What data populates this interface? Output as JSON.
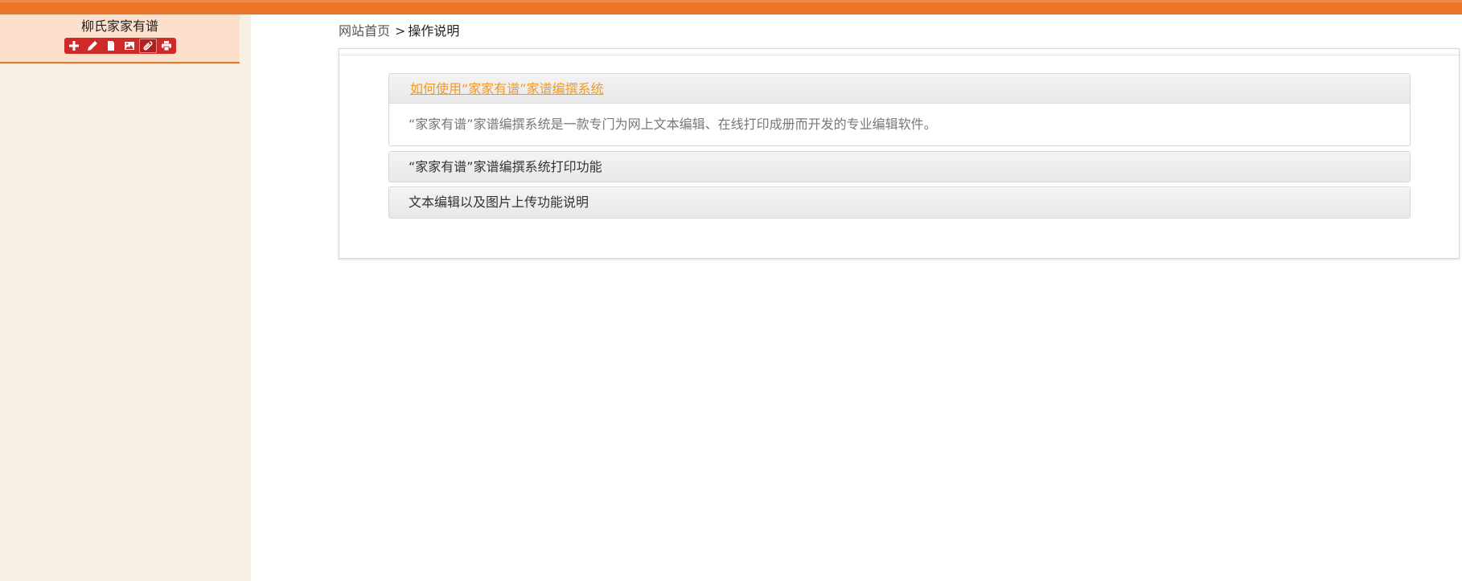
{
  "sidebar": {
    "site_name": "柳氏家家有谱",
    "tools": [
      {
        "icon": "plus-icon"
      },
      {
        "icon": "pencil-icon"
      },
      {
        "icon": "document-icon"
      },
      {
        "icon": "image-icon"
      },
      {
        "icon": "paperclip-icon",
        "active": true
      },
      {
        "icon": "print-icon"
      }
    ]
  },
  "breadcrumb": {
    "home": "网站首页",
    "separator": ">",
    "current": "操作说明"
  },
  "accordion": [
    {
      "title": "如何使用“家家有谱”家谱编撰系统",
      "expanded": true,
      "body": "“家家有谱”家谱编撰系统是一款专门为网上文本编辑、在线打印成册而开发的专业编辑软件。"
    },
    {
      "title": "“家家有谱”家谱编撰系统打印功能",
      "expanded": false
    },
    {
      "title": "文本编辑以及图片上传功能说明",
      "expanded": false
    }
  ],
  "colors": {
    "accent": "#ec7428",
    "toolbar": "#cf2a2a",
    "link_active": "#f39a1e",
    "sidebar_bg": "#f8f0e2"
  }
}
